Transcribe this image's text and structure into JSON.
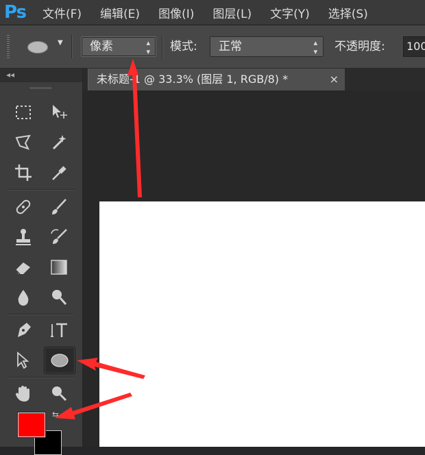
{
  "app": {
    "logo": "Ps"
  },
  "menu": [
    "文件(F)",
    "编辑(E)",
    "图像(I)",
    "图层(L)",
    "文字(Y)",
    "选择(S)"
  ],
  "options": {
    "mode_select_value": "像素",
    "mode_label": "模式:",
    "blend_value": "正常",
    "opacity_label": "不透明度:",
    "opacity_value": "100"
  },
  "toolbar": {
    "collapse_glyph": "◂◂"
  },
  "document": {
    "tab_title": "未标题-1 @ 33.3% (图层 1, RGB/8) *",
    "close_glyph": "×"
  },
  "colors": {
    "foreground": "#ff0000",
    "background": "#000000",
    "annotation_arrow": "#ff2b2b"
  },
  "icons": [
    "marquee-icon",
    "move-icon",
    "lasso-icon",
    "magic-wand-icon",
    "crop-icon",
    "eyedropper-icon",
    "healing-brush-icon",
    "brush-icon",
    "clone-stamp-icon",
    "history-brush-icon",
    "eraser-icon",
    "gradient-icon",
    "blur-icon",
    "dodge-icon",
    "pen-icon",
    "type-icon",
    "path-select-icon",
    "ellipse-icon",
    "hand-icon",
    "zoom-icon"
  ]
}
